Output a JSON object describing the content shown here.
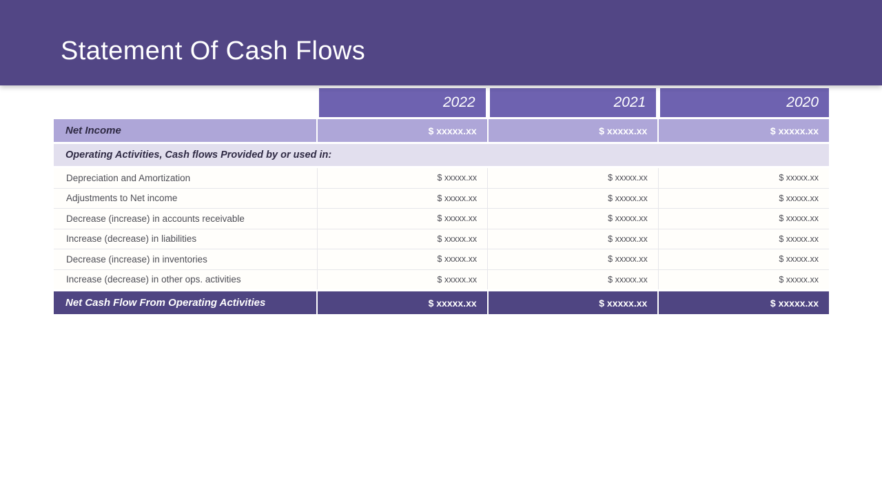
{
  "slide": {
    "title": "Statement Of Cash Flows",
    "header_color": "#524685",
    "accent_color": "#6e62b0",
    "highlight_row_color": "#aea6d8",
    "section_row_color": "#e2dfee",
    "total_row_color": "#4f4582"
  },
  "table": {
    "label_column_header": "",
    "year_headers": [
      "2022",
      "2021",
      "2020"
    ],
    "net_income": {
      "label": "Net Income",
      "values": [
        "$ xxxxx.xx",
        "$ xxxxx.xx",
        "$ xxxxx.xx"
      ]
    },
    "section": {
      "label": "Operating Activities, Cash flows Provided by or used in:"
    },
    "rows": [
      {
        "label": "Depreciation and Amortization",
        "values": [
          "$ xxxxx.xx",
          "$ xxxxx.xx",
          "$ xxxxx.xx"
        ]
      },
      {
        "label": "Adjustments  to Net income",
        "values": [
          "$ xxxxx.xx",
          "$ xxxxx.xx",
          "$ xxxxx.xx"
        ]
      },
      {
        "label": "Decrease (increase) in accounts receivable",
        "values": [
          "$ xxxxx.xx",
          "$ xxxxx.xx",
          "$ xxxxx.xx"
        ]
      },
      {
        "label": "Increase (decrease) in liabilities",
        "values": [
          "$ xxxxx.xx",
          "$ xxxxx.xx",
          "$ xxxxx.xx"
        ]
      },
      {
        "label": "Decrease (increase) in inventories",
        "values": [
          "$ xxxxx.xx",
          "$ xxxxx.xx",
          "$ xxxxx.xx"
        ]
      },
      {
        "label": "Increase (decrease) in other ops. activities",
        "values": [
          "$ xxxxx.xx",
          "$ xxxxx.xx",
          "$ xxxxx.xx"
        ]
      }
    ],
    "total": {
      "label": "Net Cash Flow From Operating Activities",
      "values": [
        "$ xxxxx.xx",
        "$ xxxxx.xx",
        "$ xxxxx.xx"
      ]
    }
  }
}
